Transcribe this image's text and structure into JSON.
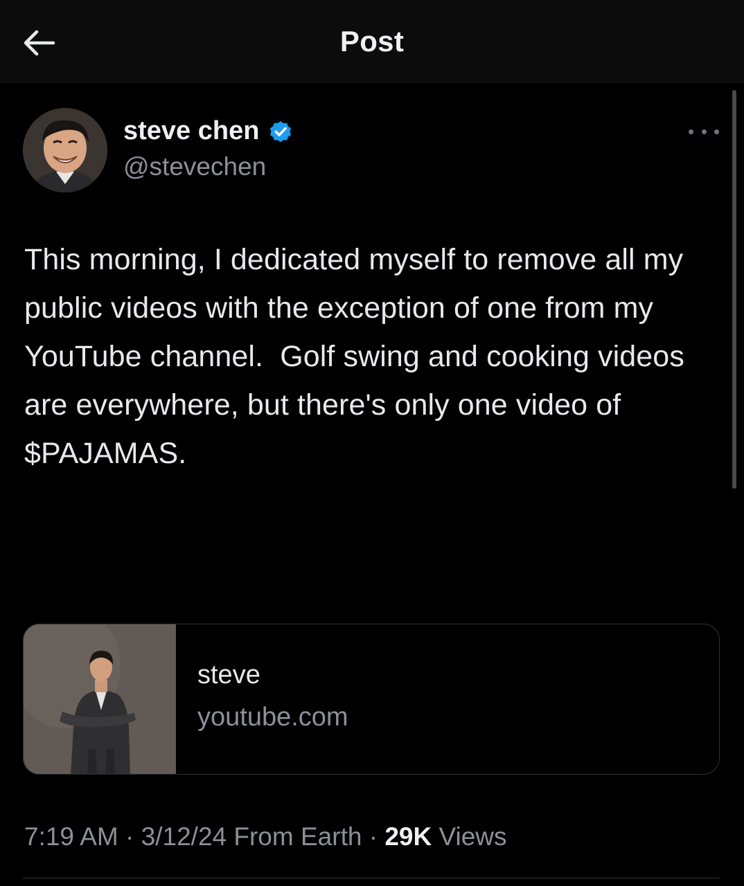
{
  "header": {
    "title": "Post",
    "back_icon": "arrow-left-icon"
  },
  "author": {
    "name": "steve chen",
    "handle": "@stevechen",
    "verified": true,
    "verified_color": "#1d9bf0"
  },
  "post": {
    "text": "This morning, I dedicated myself to remove all my public videos with the exception of one from my YouTube channel.  Golf swing and cooking videos are everywhere, but there's only one video of $PAJAMAS."
  },
  "link_card": {
    "title": "steve",
    "domain": "youtube.com"
  },
  "meta": {
    "time": "7:19 AM",
    "separator": "·",
    "date_location": "3/12/24 From Earth",
    "views_count": "29K",
    "views_label": "Views"
  },
  "colors": {
    "background": "#000000",
    "text_primary": "#e7e9ea",
    "text_secondary": "#8b9199",
    "border": "#2f3336"
  }
}
